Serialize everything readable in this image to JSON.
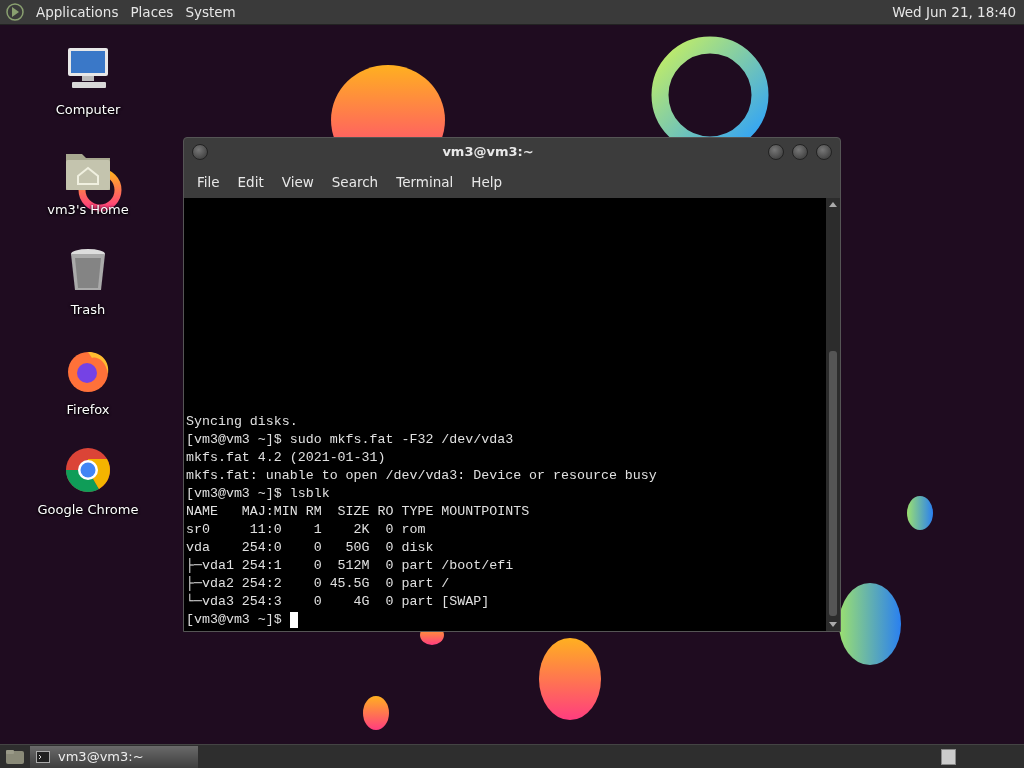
{
  "top_panel": {
    "menus": [
      "Applications",
      "Places",
      "System"
    ],
    "clock": "Wed Jun 21, 18:40"
  },
  "desktop_icons": [
    {
      "label": "Computer",
      "kind": "computer"
    },
    {
      "label": "vm3's Home",
      "kind": "home"
    },
    {
      "label": "Trash",
      "kind": "trash"
    },
    {
      "label": "Firefox",
      "kind": "firefox"
    },
    {
      "label": "Google Chrome",
      "kind": "chrome"
    }
  ],
  "terminal": {
    "title": "vm3@vm3:~",
    "menu": [
      "File",
      "Edit",
      "View",
      "Search",
      "Terminal",
      "Help"
    ],
    "lines": [
      "Syncing disks.",
      "[vm3@vm3 ~]$ sudo mkfs.fat -F32 /dev/vda3",
      "mkfs.fat 4.2 (2021-01-31)",
      "mkfs.fat: unable to open /dev/vda3: Device or resource busy",
      "[vm3@vm3 ~]$ lsblk",
      "NAME   MAJ:MIN RM  SIZE RO TYPE MOUNTPOINTS",
      "sr0     11:0    1    2K  0 rom",
      "vda    254:0    0   50G  0 disk",
      "├─vda1 254:1    0  512M  0 part /boot/efi",
      "├─vda2 254:2    0 45.5G  0 part /",
      "└─vda3 254:3    0    4G  0 part [SWAP]",
      "[vm3@vm3 ~]$"
    ]
  },
  "taskbar": {
    "tasks": [
      {
        "label": "vm3@vm3:~",
        "selected": true
      }
    ]
  }
}
